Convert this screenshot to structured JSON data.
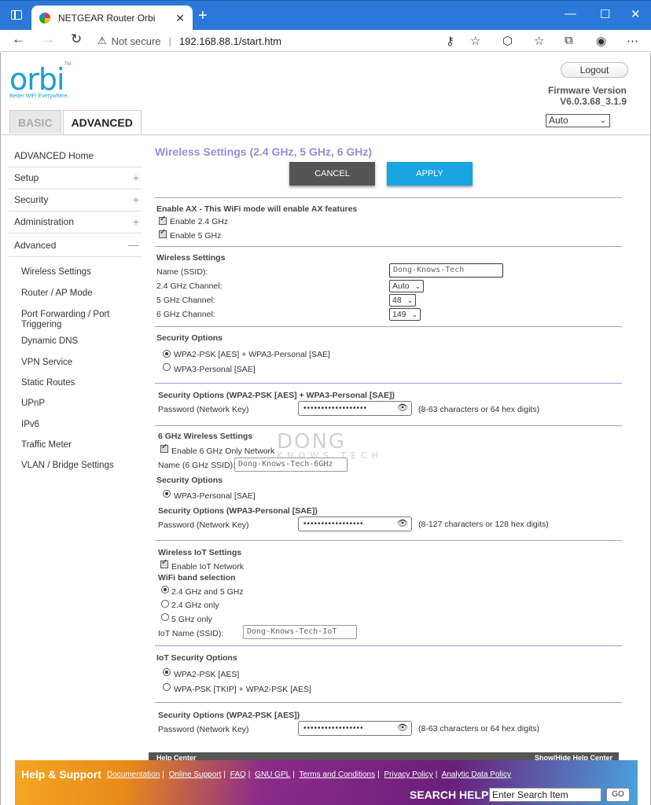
{
  "browser": {
    "tab_title": "NETGEAR Router Orbi",
    "close_glyph": "✕",
    "new_tab_glyph": "+",
    "not_secure": "Not secure",
    "url": "192.168.88.1/start.htm",
    "back": "←",
    "forward": "→",
    "refresh": "↻",
    "minimize": "—",
    "maximize": "☐",
    "close": "✕"
  },
  "header": {
    "logo_word": "orbi",
    "logo_tm": "TM",
    "logo_tagline": "Better WiFi Everywhere.",
    "logout": "Logout",
    "firmware_label": "Firmware Version",
    "firmware_value": "V6.0.3.68_3.1.9",
    "tabs": [
      "BASIC",
      "ADVANCED"
    ],
    "language": "Auto"
  },
  "sidebar": {
    "items": [
      {
        "label": "ADVANCED Home",
        "toggle": ""
      },
      {
        "label": "Setup",
        "toggle": "+"
      },
      {
        "label": "Security",
        "toggle": "+"
      },
      {
        "label": "Administration",
        "toggle": "+"
      },
      {
        "label": "Advanced",
        "toggle": "—"
      }
    ],
    "sub_items": [
      "Wireless Settings",
      "Router / AP Mode",
      "Port Forwarding / Port Triggering",
      "Dynamic DNS",
      "VPN Service",
      "Static Routes",
      "UPnP",
      "IPv6",
      "Traffic Meter",
      "VLAN / Bridge Settings"
    ]
  },
  "main": {
    "title": "Wireless Settings (2.4 GHz, 5 GHz, 6 GHz)",
    "cancel": "CANCEL",
    "apply": "APPLY",
    "ax": {
      "title": "Enable AX - This WiFi mode will enable AX features",
      "enable_24": "Enable 2.4 GHz",
      "enable_5": "Enable 5 GHz"
    },
    "wireless": {
      "title": "Wireless Settings",
      "ssid_label": "Name (SSID):",
      "ssid_value": "Dong-Knows-Tech",
      "ch24_label": "2.4 GHz Channel:",
      "ch24_value": "Auto",
      "ch5_label": "5 GHz Channel:",
      "ch5_value": "48",
      "ch6_label": "6 GHz Channel:",
      "ch6_value": "149"
    },
    "security": {
      "title": "Security Options",
      "opt1": "WPA2-PSK [AES] + WPA3-Personal [SAE]",
      "opt2": "WPA3-Personal [SAE]"
    },
    "sec_detail": {
      "title": "Security Options (WPA2-PSK [AES] + WPA3-Personal [SAE])",
      "pw_label": "Password (Network Key)",
      "pw_dots": "••••••••••••••••••",
      "hint": "(8-63 characters or 64 hex digits)"
    },
    "six": {
      "title": "6 GHz Wireless Settings",
      "enable_only": "Enable 6 GHz Only Network",
      "ssid_label": "Name (6 GHz SSID):",
      "ssid_value": "Dong-Knows-Tech-6GHz",
      "sec_title": "Security Options",
      "sec_opt": "WPA3-Personal [SAE]",
      "sec_detail_title": "Security Options (WPA3-Personal [SAE])",
      "pw_label": "Password (Network Key)",
      "pw_dots": "•••••••••••••••••",
      "hint": "(8-127 characters or 128 hex digits)"
    },
    "iot": {
      "title": "Wireless IoT Settings",
      "enable": "Enable IoT Network",
      "band_title": "WiFi band selection",
      "band1": "2.4 GHz and 5 GHz",
      "band2": "2.4 GHz only",
      "band3": "5 GHz only",
      "ssid_label": "IoT Name (SSID):",
      "ssid_value": "Dong-Knows-Tech-IoT"
    },
    "iot_sec": {
      "title": "IoT Security Options",
      "opt1": "WPA2-PSK [AES]",
      "opt2": "WPA-PSK [TKIP] + WPA2-PSK [AES]",
      "detail_title": "Security Options (WPA2-PSK [AES])",
      "pw_label": "Password (Network Key)",
      "pw_dots": "•••••••••••••••••",
      "hint": "(8-63 characters or 64 hex digits)"
    },
    "watermark": "DONG",
    "watermark_sub": "KNOWS TECH"
  },
  "helpbar": {
    "left": "Help Center",
    "right": "Show/Hide Help Center"
  },
  "footer": {
    "title": "Help & Support",
    "links": [
      "Documentation",
      "Online Support",
      "FAQ",
      "GNU GPL",
      "Terms and Conditions",
      "Privacy Policy",
      "Analytic Data Policy"
    ],
    "search_label": "SEARCH HELP",
    "search_value": "Enter Search Item",
    "go": "GO"
  }
}
